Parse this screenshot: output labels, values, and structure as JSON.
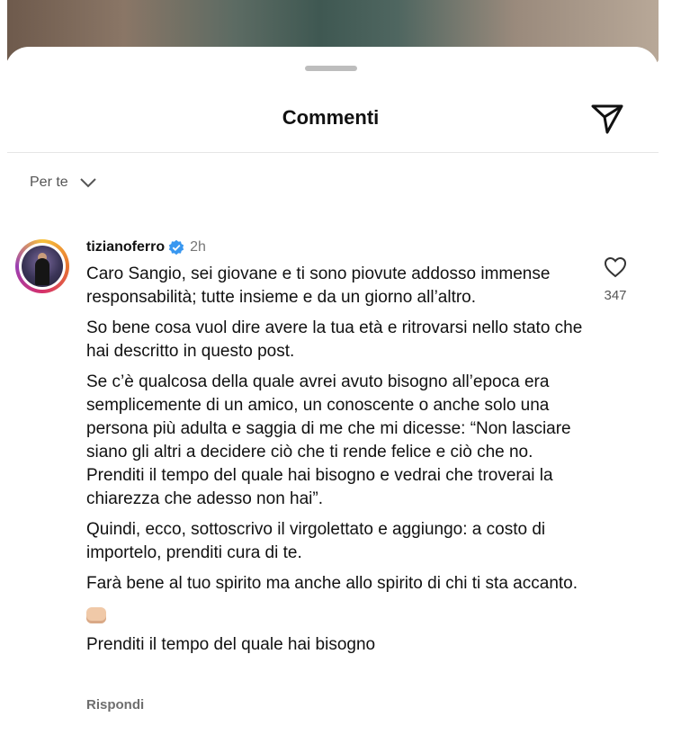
{
  "header": {
    "title": "Commenti"
  },
  "sort": {
    "label": "Per te"
  },
  "comment": {
    "username": "tizianoferro",
    "time": "2h",
    "likes": "347",
    "paragraphs": [
      "Caro Sangio, sei giovane e ti sono piovute addosso immense responsabilità; tutte insieme e da un giorno all’altro.",
      "So bene cosa vuol dire avere la tua età e ritrovarsi nello stato che hai descritto in questo post.",
      "Se c’è qualcosa della quale avrei avuto bisogno all’epoca era semplicemente di un amico, un conoscente o anche solo una persona più adulta e saggia di me che mi dicesse: “Non lasciare siano gli altri a decidere ciò che ti rende felice e ciò che no. Prenditi il tempo del quale hai bisogno e vedrai che troverai la chiarezza che adesso non hai”.",
      "Quindi, ecco, sottoscrivo il virgolettato e aggiungo: a costo di importelo, prenditi cura di te.",
      "Farà bene al tuo spirito ma anche allo spirito di chi ti sta accanto."
    ],
    "closing": "Prenditi il tempo del quale hai bisogno",
    "reply_label": "Rispondi"
  },
  "icons": {
    "share": "paper-plane-icon",
    "verified": "verified-badge-icon",
    "like": "heart-icon",
    "sort": "chevron-down-icon",
    "emoji": "fist-emoji-icon"
  },
  "colors": {
    "verified": "#3897f0",
    "muted": "#777777"
  }
}
